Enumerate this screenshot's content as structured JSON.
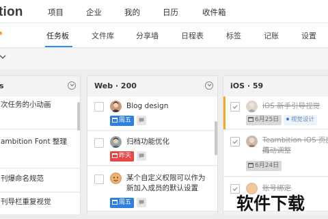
{
  "app": {
    "brand": "tion"
  },
  "top_nav": {
    "items": [
      "项目",
      "企业",
      "我的",
      "日历",
      "收件箱"
    ]
  },
  "sub_nav": {
    "items": [
      "任务板",
      "文件库",
      "分享墙",
      "日程表",
      "标签",
      "记账",
      "设置"
    ],
    "active": "任务板"
  },
  "columns": [
    {
      "title": "",
      "cards": [
        {
          "title": "次任务的小动画"
        },
        {
          "title": "ambition Font 整理"
        },
        {
          "title": "刊爆命名规范"
        },
        {
          "title": "刊导栏重复视觉"
        }
      ]
    },
    {
      "title": "Web · 200",
      "cards": [
        {
          "title": "Blog design",
          "badge": "周五",
          "badge_color": "#2d7fe0"
        },
        {
          "title": "归档功能优化",
          "badge": "昨天",
          "badge_color": "#e84545"
        },
        {
          "title": "某个自定义权限可以作为",
          "title2": "新加入成员的默认设置",
          "badge": "周五",
          "badge_color": "#2d7fe0"
        }
      ]
    },
    {
      "title": "iOS · 59",
      "cards": [
        {
          "title": "iOS 新手引导视觉",
          "badge": "6月25日",
          "tag": "视觉设计",
          "done": true
        },
        {
          "title": "Teambition iOS 页面再",
          "title2": "搞动调整",
          "badge": "6月24日",
          "done": true
        },
        {
          "title": "账号绑定",
          "done": true
        }
      ]
    }
  ],
  "watermark": "软件下载",
  "colors": {
    "accent": "#2d8cf0",
    "badge_blue": "#2d7fe0",
    "badge_red": "#e84545",
    "orange": "#f5a623"
  }
}
